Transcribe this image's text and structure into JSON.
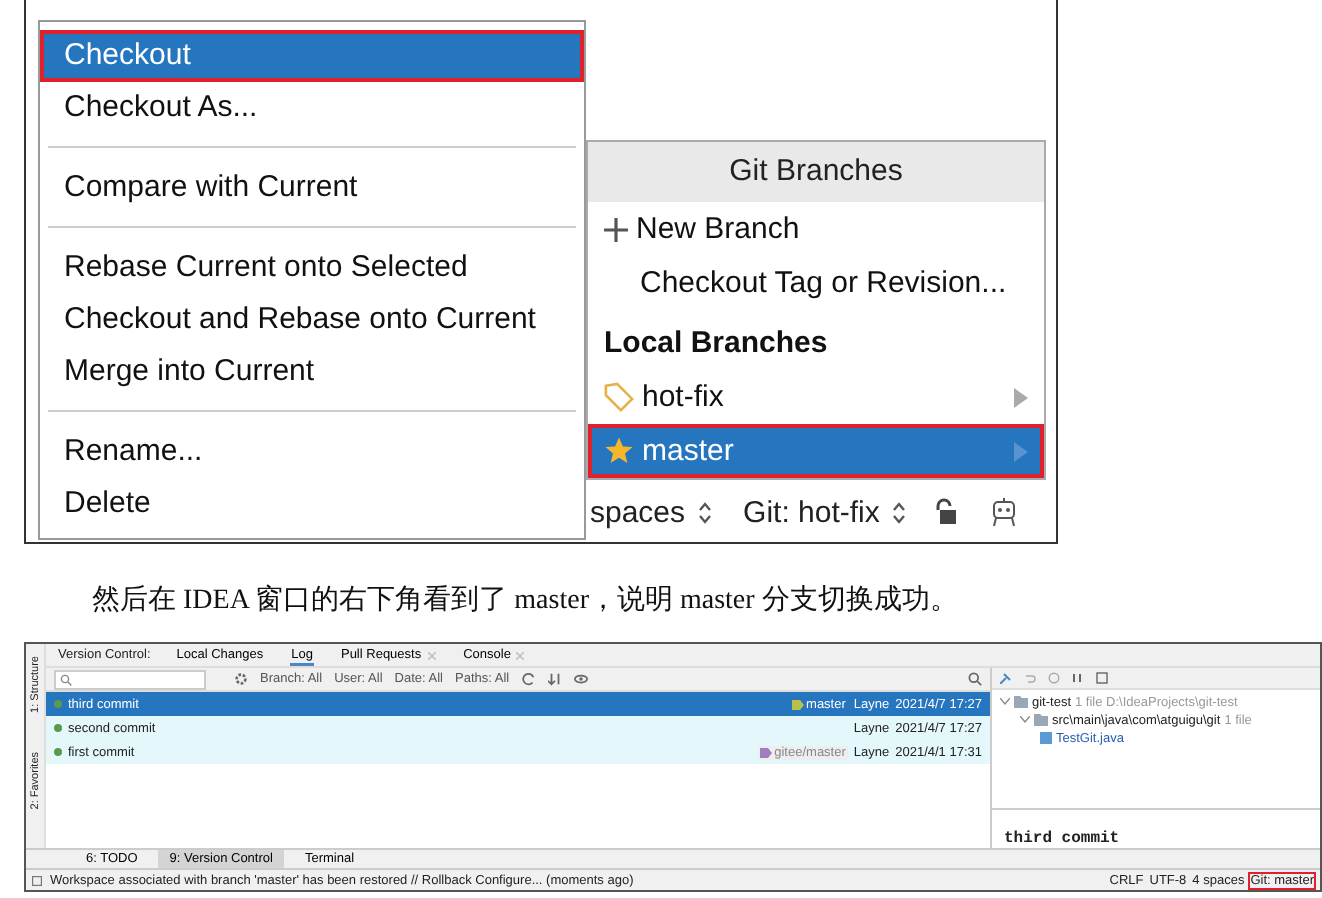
{
  "top_screenshot": {
    "context_menu": [
      {
        "kind": "item",
        "label": "Checkout",
        "selected": true,
        "outlined": true
      },
      {
        "kind": "item",
        "label": "Checkout As...",
        "selected": false,
        "outlined": false
      },
      {
        "kind": "separator"
      },
      {
        "kind": "item",
        "label": "Compare with Current",
        "selected": false,
        "outlined": false
      },
      {
        "kind": "separator"
      },
      {
        "kind": "item",
        "label": "Rebase Current onto Selected",
        "selected": false,
        "outlined": false
      },
      {
        "kind": "item",
        "label": "Checkout and Rebase onto Current",
        "selected": false,
        "outlined": false
      },
      {
        "kind": "item",
        "label": "Merge into Current",
        "selected": false,
        "outlined": false
      },
      {
        "kind": "separator"
      },
      {
        "kind": "item",
        "label": "Rename...",
        "selected": false,
        "outlined": false
      },
      {
        "kind": "item",
        "label": "Delete",
        "selected": false,
        "outlined": false
      }
    ],
    "branches_popup": {
      "title": "Git Branches",
      "items": [
        {
          "kind": "new",
          "label": "New Branch"
        },
        {
          "kind": "action",
          "label": "Checkout Tag or Revision..."
        },
        {
          "kind": "header",
          "label": "Local Branches"
        },
        {
          "kind": "branch",
          "label": "hot-fix",
          "current": false,
          "selected": false,
          "outlined": false
        },
        {
          "kind": "branch",
          "label": "master",
          "current": true,
          "selected": true,
          "outlined": true
        }
      ]
    },
    "status_bar": {
      "indent": "spaces",
      "branch": "Git: hot-fix"
    }
  },
  "caption": "然后在 IDEA 窗口的右下角看到了 master，说明 master 分支切换成功。",
  "bottom_screenshot": {
    "tool_strip": [
      "1: Structure",
      "2: Favorites"
    ],
    "tabs_label": "Version Control:",
    "tabs": [
      {
        "label": "Local Changes",
        "selected": false,
        "closable": false
      },
      {
        "label": "Log",
        "selected": true,
        "closable": false
      },
      {
        "label": "Pull Requests",
        "selected": false,
        "closable": true
      },
      {
        "label": "Console",
        "selected": false,
        "closable": true
      }
    ],
    "filters": [
      "Branch: All",
      "User: All",
      "Date: All",
      "Paths: All"
    ],
    "commits": [
      {
        "subject": "third commit",
        "refs": [
          {
            "label": "master",
            "color": "#b8c24a"
          }
        ],
        "author": "Layne",
        "date": "2021/4/7 17:27",
        "selected": true
      },
      {
        "subject": "second commit",
        "author": "Layne",
        "date": "2021/4/7 17:27",
        "selected": false
      },
      {
        "subject": "first commit",
        "refs": [
          {
            "label": "gitee/master",
            "color": "#a07cc0"
          }
        ],
        "author": "Layne",
        "date": "2021/4/1 17:31",
        "selected": false
      }
    ],
    "changes_tree": [
      {
        "name": "git-test",
        "info": "1 file D:\\IdeaProjects\\git-test",
        "children": [
          {
            "name": "src\\main\\java\\com\\atguigu\\git",
            "info": "1 file",
            "children": [
              {
                "name": "TestGit.java"
              }
            ]
          }
        ]
      }
    ],
    "commit_message": "third commit",
    "tool_windows": [
      {
        "label": "6: TODO",
        "selected": false
      },
      {
        "label": "9: Version Control",
        "selected": true
      },
      {
        "label": "Terminal",
        "selected": false
      }
    ],
    "status_bar": {
      "message": "Workspace associated with branch 'master' has been restored // Rollback  Configure... (moments ago)",
      "widgets": [
        {
          "label": "CRLF",
          "outlined": false
        },
        {
          "label": "UTF-8",
          "outlined": false
        },
        {
          "label": "4 spaces",
          "outlined": false
        },
        {
          "label": "Git: master",
          "outlined": true
        }
      ]
    }
  }
}
